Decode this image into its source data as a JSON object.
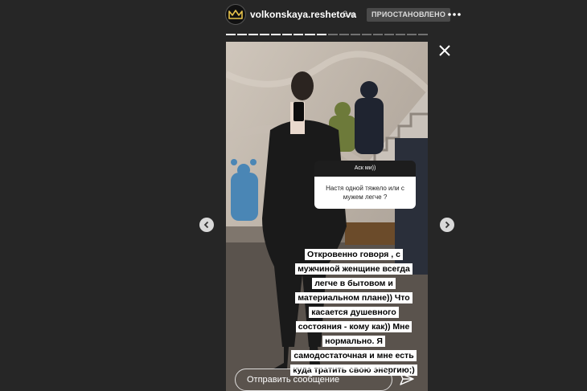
{
  "header": {
    "username": "volkonskaya.reshetova",
    "time": "6 ч.",
    "status_badge": "ПРИОСТАНОВЛЕНО",
    "more_icon": "more-horizontal-icon"
  },
  "progress": {
    "total_segments": 18,
    "completed_segments": 9
  },
  "story": {
    "question_sticker": {
      "header": "Аск ми))",
      "question": "Настя одной тяжело или с мужем легче ?"
    },
    "answer_lines": [
      "Откровенно говоря , с",
      "мужчиной женщине всегда",
      "легче в бытовом и",
      "материальном плане)) Что",
      "касается душевного",
      "состояния - кому как)) Мне",
      "нормально. Я",
      "самодостаточная и мне есть",
      "куда тратить свою энергию;)"
    ]
  },
  "reply": {
    "placeholder": "Отправить сообщение"
  },
  "colors": {
    "background": "#262626",
    "badge": "#4a4a4a"
  }
}
